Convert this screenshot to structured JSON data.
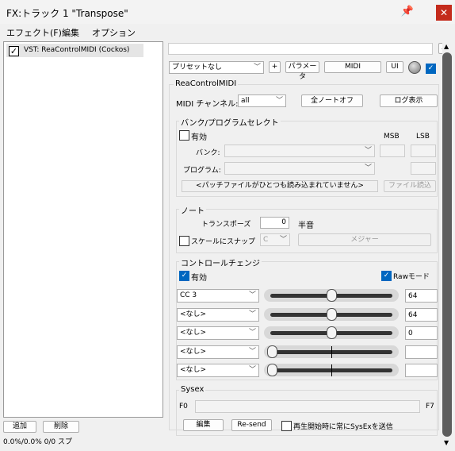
{
  "window": {
    "title": "FX:トラック 1 \"Transpose\"",
    "pin_icon": "pin-icon",
    "close_icon": "close-icon"
  },
  "menu": [
    "エフェクト(F)",
    "編集",
    "オプション"
  ],
  "fx_list": {
    "items": [
      {
        "label": "VST: ReaControlMIDI (Cockos)",
        "checked": true
      }
    ]
  },
  "bottom": {
    "add": "追加",
    "remove": "削除",
    "status": "0.0%/0.0% 0/0 スプ"
  },
  "top": {
    "preset": "プリセットなし",
    "plus": "+",
    "params": "パラメータ",
    "midi": "MIDI",
    "ui": "UI"
  },
  "plugin": {
    "name": "ReaControlMIDI",
    "channel_label": "MIDI チャンネル:",
    "channel": "all",
    "all_notes_off": "全ノートオフ",
    "log": "ログ表示",
    "bank": {
      "title": "バンク/プログラムセレクト",
      "enable": "有効",
      "enabled": false,
      "msb": "MSB",
      "lsb": "LSB",
      "bank_label": "バンク:",
      "program_label": "プログラム:",
      "patch_msg": "<パッチファイルがひとつも読み込まれていません>",
      "load_file": "ファイル読込"
    },
    "note": {
      "title": "ノート",
      "transpose_label": "トランスポーズ",
      "transpose": "0",
      "semitone": "半音",
      "snap_label": "スケールにスナップ",
      "snap": false,
      "root": "C",
      "scale": "メジャー"
    },
    "cc": {
      "title": "コントロールチェンジ",
      "enable": "有効",
      "enabled": true,
      "raw": "Rawモード",
      "raw_enabled": true,
      "rows": [
        {
          "select": "CC 3",
          "value": "64",
          "level": 64
        },
        {
          "select": "<なし>",
          "value": "64",
          "level": 64
        },
        {
          "select": "<なし>",
          "value": "0",
          "level": 64
        },
        {
          "select": "<なし>",
          "value": "",
          "level": 0
        },
        {
          "select": "<なし>",
          "value": "",
          "level": 0
        }
      ]
    },
    "sysex": {
      "title": "Sysex",
      "f0": "F0",
      "f7": "F7",
      "edit": "編集",
      "resend": "Re-send",
      "send_on_start": "再生開始時に常にSysExを送信",
      "send_on_start_checked": false
    }
  }
}
